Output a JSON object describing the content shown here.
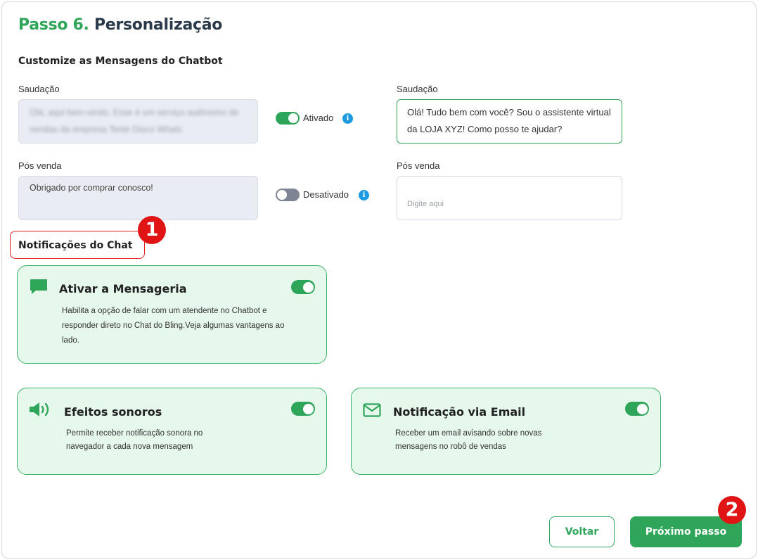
{
  "header": {
    "step": "Passo 6.",
    "title": "Personalização"
  },
  "messages": {
    "section_title": "Customize as Mensagens do Chatbot",
    "greeting": {
      "label_left": "Saudação",
      "default_text": "Olá, aqui bem-vindo. Esse é um serviço autônomo de vendas da empresa Teste Disco Whats",
      "toggle_label": "Ativado",
      "toggle_on": true,
      "label_right": "Saudação",
      "custom_value": "Olá! Tudo bem com você? Sou o assistente virtual da LOJA XYZ! Como posso te ajudar?"
    },
    "post_sale": {
      "label_left": "Pós venda",
      "default_text": "Obrigado por comprar conosco!",
      "toggle_label": "Desativado",
      "toggle_on": false,
      "label_right": "Pós venda",
      "placeholder": "Digite aqui"
    }
  },
  "notifications": {
    "section_title": "Notificações do Chat",
    "callout_number": "1",
    "cards": [
      {
        "title": "Ativar a Mensageria",
        "icon": "chat-bubble-icon",
        "enabled": true,
        "description": "Habilita a opção de falar com um atendente no Chatbot e responder direto no Chat do Bling.Veja algumas vantagens ao lado."
      },
      {
        "title": "Efeitos sonoros",
        "icon": "speaker-icon",
        "enabled": true,
        "description": "Permite receber notificação sonora no navegador a cada nova mensagem"
      },
      {
        "title": "Notificação via Email",
        "icon": "envelope-icon",
        "enabled": true,
        "description": "Receber um email avisando sobre novas mensagens no robô de vendas"
      }
    ]
  },
  "footer": {
    "back_label": "Voltar",
    "next_label": "Próximo passo",
    "callout_number": "2"
  },
  "colors": {
    "accent": "#2ea559",
    "card_bg": "#e6f7ec",
    "callout": "#e01414",
    "info": "#1e9be0"
  }
}
